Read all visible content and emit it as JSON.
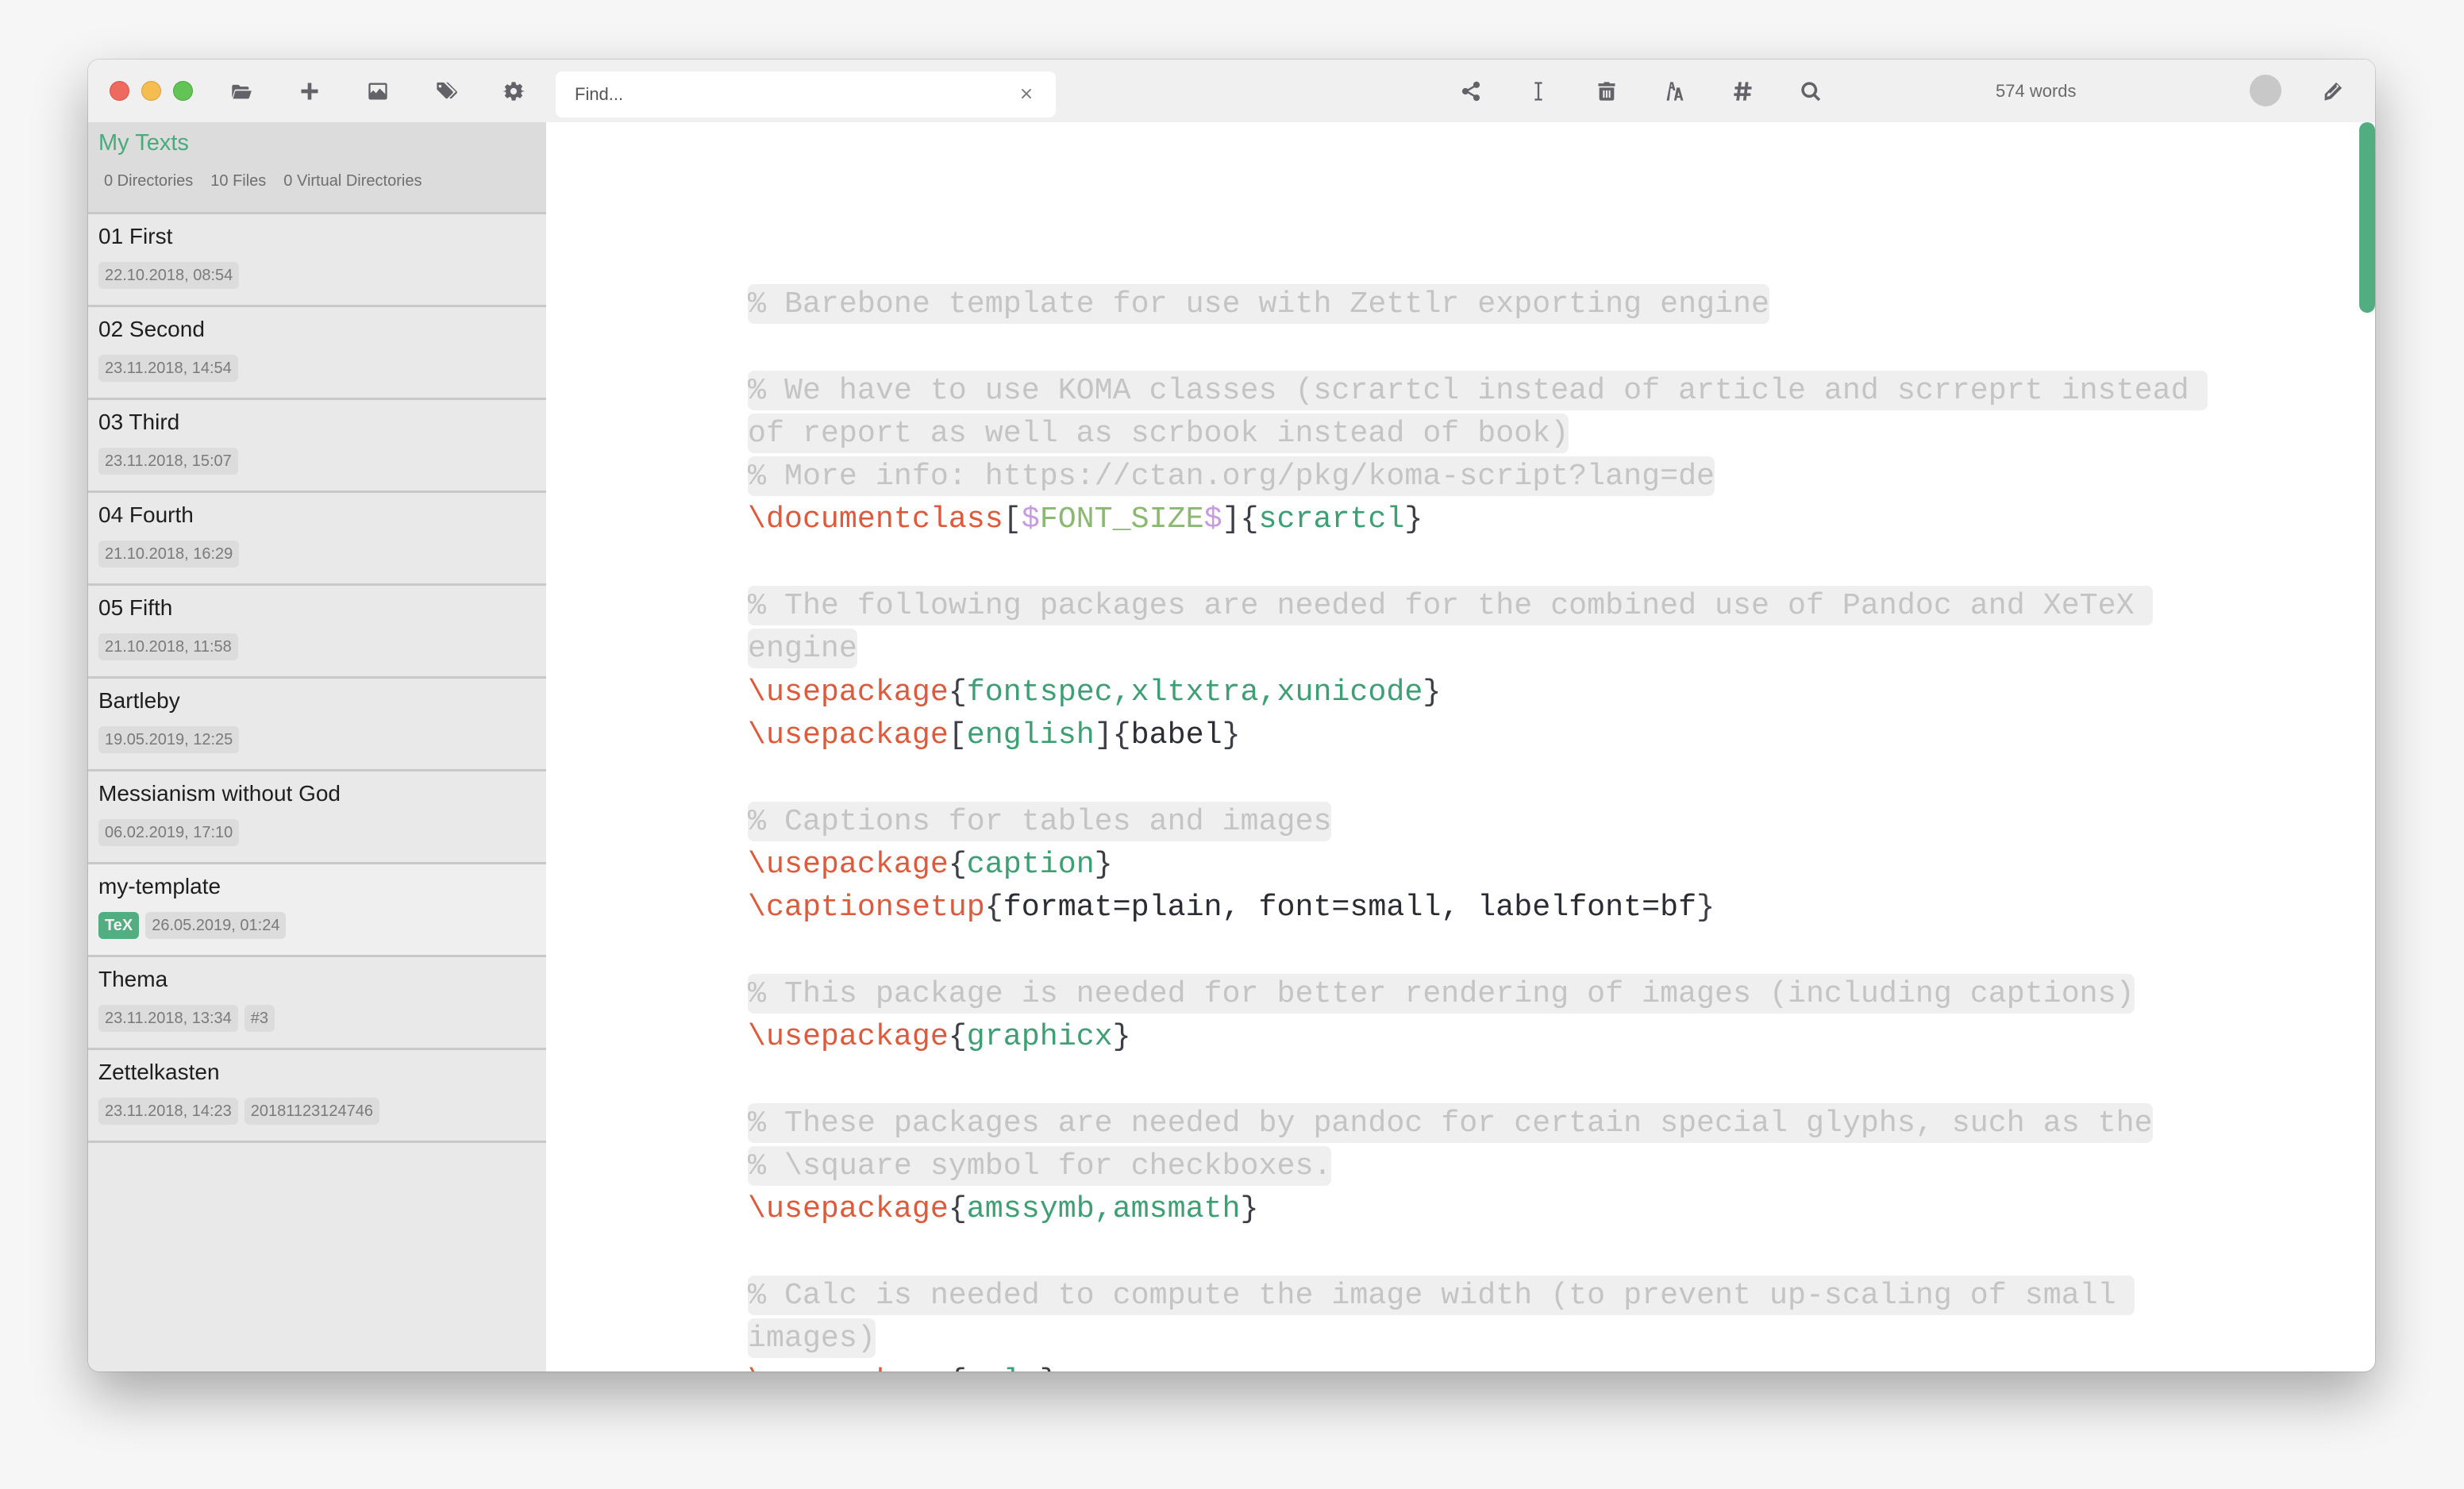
{
  "window": {
    "traffic_lights": [
      "close",
      "minimize",
      "maximize"
    ]
  },
  "toolbar": {
    "left_icons": [
      {
        "name": "open-directory-icon",
        "label": "Open directory"
      },
      {
        "name": "new-file-icon",
        "label": "New file"
      },
      {
        "name": "image-icon",
        "label": "Image"
      },
      {
        "name": "tags-icon",
        "label": "Tags"
      },
      {
        "name": "settings-gear-icon",
        "label": "Preferences"
      }
    ],
    "search": {
      "placeholder": "Find...",
      "value": "",
      "clear_glyph": "×"
    },
    "right_icons": [
      {
        "name": "share-icon",
        "label": "Export"
      },
      {
        "name": "text-cursor-icon",
        "label": "Typewriter"
      },
      {
        "name": "trash-icon",
        "label": "Delete"
      },
      {
        "name": "font-size-icon",
        "label": "Font"
      },
      {
        "name": "hashtag-icon",
        "label": "Tags"
      },
      {
        "name": "search-icon",
        "label": "Search"
      }
    ],
    "word_count": "574 words",
    "edit_icon": "pen-icon"
  },
  "sidebar": {
    "directory_title": "My Texts",
    "meta": [
      "0 Directories",
      "10 Files",
      "0 Virtual Directories"
    ],
    "files": [
      {
        "name": "01 First",
        "badges": [
          {
            "text": "22.10.2018, 08:54"
          }
        ]
      },
      {
        "name": "02 Second",
        "badges": [
          {
            "text": "23.11.2018, 14:54"
          }
        ]
      },
      {
        "name": "03 Third",
        "badges": [
          {
            "text": "23.11.2018, 15:07"
          }
        ]
      },
      {
        "name": "04 Fourth",
        "badges": [
          {
            "text": "21.10.2018, 16:29"
          }
        ]
      },
      {
        "name": "05 Fifth",
        "badges": [
          {
            "text": "21.10.2018, 11:58"
          }
        ]
      },
      {
        "name": "Bartleby",
        "badges": [
          {
            "text": "19.05.2019, 12:25"
          }
        ]
      },
      {
        "name": "Messianism without God",
        "badges": [
          {
            "text": "06.02.2019, 17:10"
          }
        ]
      },
      {
        "name": "my-template",
        "selected": true,
        "badges": [
          {
            "text": "TeX",
            "type": "tex"
          },
          {
            "text": "26.05.2019, 01:24"
          }
        ]
      },
      {
        "name": "Thema",
        "badges": [
          {
            "text": "23.11.2018, 13:34"
          },
          {
            "text": "#3"
          }
        ]
      },
      {
        "name": "Zettelkasten",
        "badges": [
          {
            "text": "23.11.2018, 14:23"
          },
          {
            "text": "20181123124746"
          }
        ]
      }
    ]
  },
  "editor": {
    "lines": [
      [
        {
          "t": "comment",
          "s": "% Barebone template for use with Zettlr exporting engine"
        }
      ],
      [],
      [
        {
          "t": "comment",
          "s": "% We have to use KOMA classes (scrartcl instead of article and scrreprt instead "
        }
      ],
      [
        {
          "t": "comment",
          "s": "of report as well as scrbook instead of book)"
        }
      ],
      [
        {
          "t": "comment",
          "s": "% More info: https://ctan.org/pkg/koma-script?lang=de"
        }
      ],
      [
        {
          "t": "cmd",
          "s": "\\documentclass"
        },
        {
          "t": "br",
          "s": "["
        },
        {
          "t": "dollar",
          "s": "$"
        },
        {
          "t": "var",
          "s": "FONT_SIZE"
        },
        {
          "t": "dollar",
          "s": "$"
        },
        {
          "t": "br",
          "s": "]{"
        },
        {
          "t": "arg",
          "s": "scrartcl"
        },
        {
          "t": "br",
          "s": "}"
        }
      ],
      [],
      [
        {
          "t": "comment",
          "s": "% The following packages are needed for the combined use of Pandoc and XeTeX "
        }
      ],
      [
        {
          "t": "comment",
          "s": "engine"
        }
      ],
      [
        {
          "t": "cmd",
          "s": "\\usepackage"
        },
        {
          "t": "br",
          "s": "{"
        },
        {
          "t": "arg",
          "s": "fontspec,xltxtra,xunicode"
        },
        {
          "t": "br",
          "s": "}"
        }
      ],
      [
        {
          "t": "cmd",
          "s": "\\usepackage"
        },
        {
          "t": "br",
          "s": "["
        },
        {
          "t": "arg",
          "s": "english"
        },
        {
          "t": "br",
          "s": "]{"
        },
        {
          "t": "plain",
          "s": "babel"
        },
        {
          "t": "br",
          "s": "}"
        }
      ],
      [],
      [
        {
          "t": "comment",
          "s": "% Captions for tables and images"
        }
      ],
      [
        {
          "t": "cmd",
          "s": "\\usepackage"
        },
        {
          "t": "br",
          "s": "{"
        },
        {
          "t": "arg",
          "s": "caption"
        },
        {
          "t": "br",
          "s": "}"
        }
      ],
      [
        {
          "t": "cmd",
          "s": "\\captionsetup"
        },
        {
          "t": "br",
          "s": "{"
        },
        {
          "t": "plain",
          "s": "format=plain, font=small, labelfont=bf"
        },
        {
          "t": "br",
          "s": "}"
        }
      ],
      [],
      [
        {
          "t": "comment",
          "s": "% This package is needed for better rendering of images (including captions)"
        }
      ],
      [
        {
          "t": "cmd",
          "s": "\\usepackage"
        },
        {
          "t": "br",
          "s": "{"
        },
        {
          "t": "arg",
          "s": "graphicx"
        },
        {
          "t": "br",
          "s": "}"
        }
      ],
      [],
      [
        {
          "t": "comment",
          "s": "% These packages are needed by pandoc for certain special glyphs, such as the"
        }
      ],
      [
        {
          "t": "comment",
          "s": "% \\square symbol for checkboxes."
        }
      ],
      [
        {
          "t": "cmd",
          "s": "\\usepackage"
        },
        {
          "t": "br",
          "s": "{"
        },
        {
          "t": "arg",
          "s": "amssymb,amsmath"
        },
        {
          "t": "br",
          "s": "}"
        }
      ],
      [],
      [
        {
          "t": "comment",
          "s": "% Calc is needed to compute the image width (to prevent up-scaling of small "
        }
      ],
      [
        {
          "t": "comment",
          "s": "images)"
        }
      ],
      [
        {
          "t": "cmd",
          "s": "\\usepackage"
        },
        {
          "t": "br",
          "s": "{"
        },
        {
          "t": "arg",
          "s": "calc"
        },
        {
          "t": "br",
          "s": "}"
        }
      ]
    ]
  },
  "colors": {
    "accent": "#52ae80",
    "command": "#dd5b3c",
    "argument": "#3f9f74",
    "variable": "#8bb873",
    "dollar": "#c79be0",
    "comment_text": "#c4c4c4",
    "comment_bg": "#efefef"
  }
}
